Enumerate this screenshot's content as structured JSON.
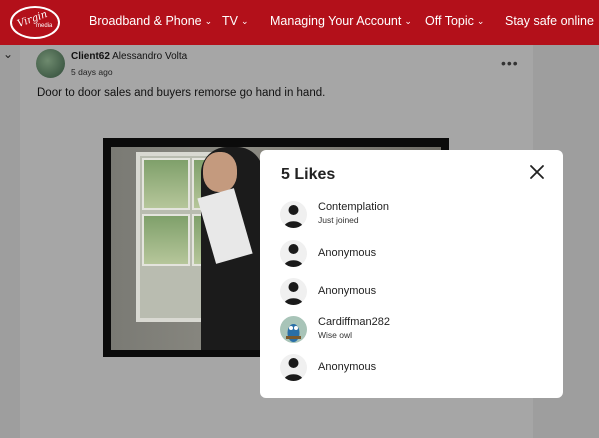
{
  "nav": {
    "items": [
      {
        "label": "Broadband & Phone"
      },
      {
        "label": "TV"
      },
      {
        "label": "Managing Your Account"
      },
      {
        "label": "Off Topic"
      },
      {
        "label": "Stay safe online"
      }
    ],
    "chevron": "⌄"
  },
  "logo": {
    "text_main": "Virgin",
    "text_sub": "media"
  },
  "post": {
    "username": "Client62",
    "real_name": "Alessandro Volta",
    "time": "5 days ago",
    "body": "Door to door sales and buyers remorse go hand in hand.",
    "menu": "•••"
  },
  "modal": {
    "title": "5 Likes",
    "likers": [
      {
        "name": "Contemplation",
        "rank": "Just joined",
        "avatar": "default-user-icon"
      },
      {
        "name": "Anonymous",
        "rank": "",
        "avatar": "default-user-icon"
      },
      {
        "name": "Anonymous",
        "rank": "",
        "avatar": "default-user-icon"
      },
      {
        "name": "Cardiffman282",
        "rank": "Wise owl",
        "avatar": "wise-owl-avatar"
      },
      {
        "name": "Anonymous",
        "rank": "",
        "avatar": "default-user-icon"
      }
    ]
  },
  "colors": {
    "brand_red": "#b3101a",
    "overlay_gray": "#9e9e9e",
    "modal_bg": "#ffffff"
  }
}
